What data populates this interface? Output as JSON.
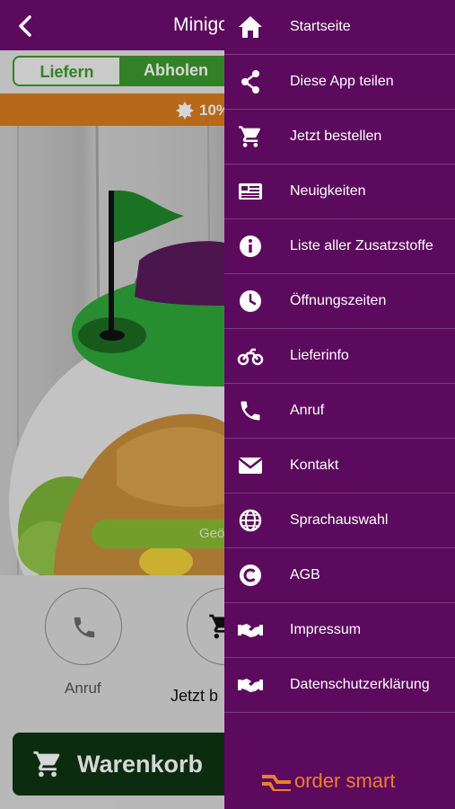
{
  "app": {
    "title": "Minigo",
    "tabs": [
      "Liefern",
      "Abholen"
    ],
    "promo_text": "10%",
    "open_pill_text": "Geö",
    "actions": [
      {
        "label": "Anruf",
        "icon": "phone-icon"
      },
      {
        "label": "Jetzt b",
        "icon": "cart-icon"
      }
    ],
    "cart_button_label": "Warenkorb"
  },
  "drawer": {
    "items": [
      {
        "label": "Startseite",
        "icon": "home-icon"
      },
      {
        "label": "Diese App teilen",
        "icon": "share-icon"
      },
      {
        "label": "Jetzt bestellen",
        "icon": "cart-icon"
      },
      {
        "label": "Neuigkeiten",
        "icon": "news-icon"
      },
      {
        "label": "Liste aller Zusatzstoffe",
        "icon": "info-icon"
      },
      {
        "label": "Öffnungszeiten",
        "icon": "clock-icon"
      },
      {
        "label": "Lieferinfo",
        "icon": "motorbike-icon"
      },
      {
        "label": "Anruf",
        "icon": "phone-icon"
      },
      {
        "label": "Kontakt",
        "icon": "envelope-icon"
      },
      {
        "label": "Sprachauswahl",
        "icon": "globe-icon"
      },
      {
        "label": "AGB",
        "icon": "copyright-icon"
      },
      {
        "label": "Impressum",
        "icon": "handshake-icon"
      },
      {
        "label": "Datenschutzerklärung",
        "icon": "handshake-icon"
      }
    ],
    "brand_name": "order smart"
  },
  "colors": {
    "drawer_bg": "#5c0a5e",
    "accent_green": "#3d9a2f",
    "promo_orange": "#d97e1e",
    "cart_button_bg": "#0f3512",
    "brand_orange": "#ef7e2c"
  }
}
